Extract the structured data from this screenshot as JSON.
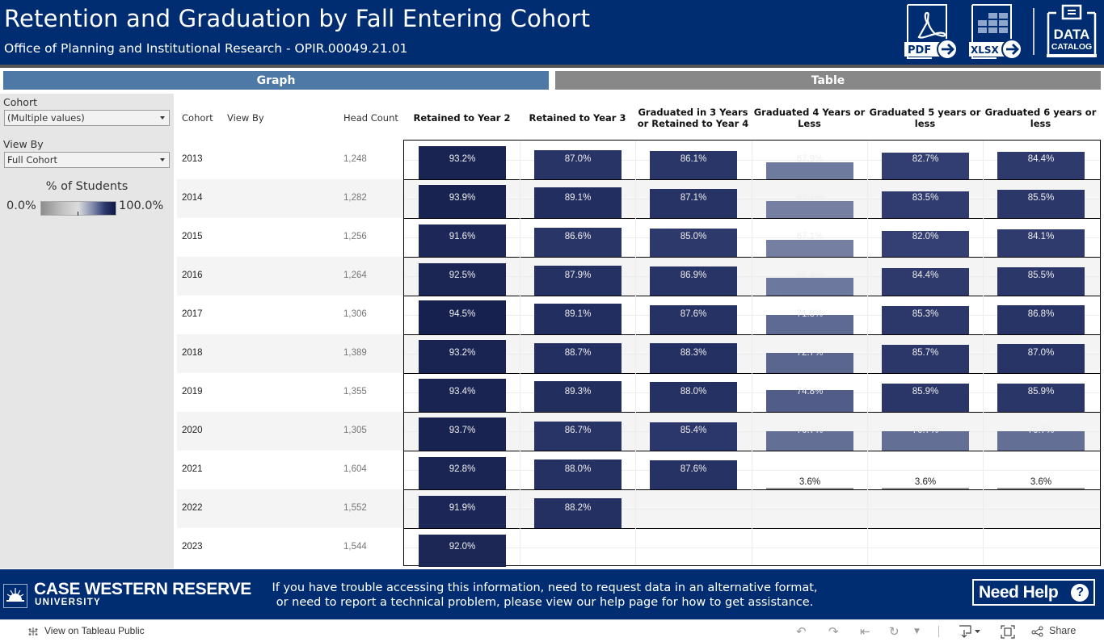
{
  "header": {
    "title": "Retention and Graduation by Fall Entering Cohort",
    "subtitle": "Office of Planning and Institutional Research - OPIR.00049.21.01",
    "pdf_label": "PDF",
    "xlsx_label": "XLSX",
    "catalog_line1": "DATA",
    "catalog_line2": "CATALOG"
  },
  "tabs": [
    {
      "label": "Graph",
      "color": "#4e79a7"
    },
    {
      "label": "Table",
      "color": "#888888"
    }
  ],
  "filters": {
    "cohort": {
      "label": "Cohort",
      "value": "(Multiple values)"
    },
    "view_by": {
      "label": "View By",
      "value": "Full Cohort"
    }
  },
  "legend": {
    "title": "% of Students",
    "min": "0.0%",
    "max": "100.0%"
  },
  "table": {
    "columns": {
      "cohort": "Cohort",
      "view_by": "View By",
      "head_count": "Head Count",
      "metrics": [
        "Retained to Year 2",
        "Retained to Year 3",
        "Graduated in 3 Years or Retained to Year 4",
        "Graduated 4 Years or Less",
        "Graduated 5 years or less",
        "Graduated 6 years or less"
      ]
    },
    "rows": [
      {
        "cohort": "2013",
        "head_count": "1,248",
        "values": [
          93.2,
          87.0,
          86.1,
          67.9,
          82.7,
          84.4
        ]
      },
      {
        "cohort": "2014",
        "head_count": "1,282",
        "values": [
          93.9,
          89.1,
          87.1,
          67.1,
          83.5,
          85.5
        ]
      },
      {
        "cohort": "2015",
        "head_count": "1,256",
        "values": [
          91.6,
          86.6,
          85.0,
          67.1,
          82.0,
          84.1
        ]
      },
      {
        "cohort": "2016",
        "head_count": "1,264",
        "values": [
          92.5,
          87.9,
          86.9,
          68.4,
          84.4,
          85.5
        ]
      },
      {
        "cohort": "2017",
        "head_count": "1,306",
        "values": [
          94.5,
          89.1,
          87.6,
          71.8,
          85.3,
          86.8
        ]
      },
      {
        "cohort": "2018",
        "head_count": "1,389",
        "values": [
          93.2,
          88.7,
          88.3,
          72.7,
          85.7,
          87.0
        ]
      },
      {
        "cohort": "2019",
        "head_count": "1,355",
        "values": [
          93.4,
          89.3,
          88.0,
          74.8,
          85.9,
          85.9
        ]
      },
      {
        "cohort": "2020",
        "head_count": "1,305",
        "values": [
          93.7,
          86.7,
          85.4,
          70.7,
          70.7,
          70.7
        ]
      },
      {
        "cohort": "2021",
        "head_count": "1,604",
        "values": [
          92.8,
          88.0,
          87.6,
          3.6,
          3.6,
          3.6
        ]
      },
      {
        "cohort": "2022",
        "head_count": "1,552",
        "values": [
          91.9,
          88.2,
          null,
          null,
          null,
          null
        ]
      },
      {
        "cohort": "2023",
        "head_count": "1,544",
        "values": [
          92.0,
          null,
          null,
          null,
          null,
          null
        ]
      }
    ]
  },
  "chart_data": {
    "type": "heatmap",
    "title": "Retention and Graduation by Fall Entering Cohort",
    "xlabel": "",
    "ylabel": "Cohort",
    "categories": [
      "2013",
      "2014",
      "2015",
      "2016",
      "2017",
      "2018",
      "2019",
      "2020",
      "2021",
      "2022",
      "2023"
    ],
    "head_count": [
      1248,
      1282,
      1256,
      1264,
      1306,
      1389,
      1355,
      1305,
      1604,
      1552,
      1544
    ],
    "series": [
      {
        "name": "Retained to Year 2",
        "values": [
          93.2,
          93.9,
          91.6,
          92.5,
          94.5,
          93.2,
          93.4,
          93.7,
          92.8,
          91.9,
          92.0
        ]
      },
      {
        "name": "Retained to Year 3",
        "values": [
          87.0,
          89.1,
          86.6,
          87.9,
          89.1,
          88.7,
          89.3,
          86.7,
          88.0,
          88.2,
          null
        ]
      },
      {
        "name": "Graduated in 3 Years or Retained to Year 4",
        "values": [
          86.1,
          87.1,
          85.0,
          86.9,
          87.6,
          88.3,
          88.0,
          85.4,
          87.6,
          null,
          null
        ]
      },
      {
        "name": "Graduated 4 Years or Less",
        "values": [
          67.9,
          67.1,
          67.1,
          68.4,
          71.8,
          72.7,
          74.8,
          70.7,
          3.6,
          null,
          null
        ]
      },
      {
        "name": "Graduated 5 years or less",
        "values": [
          82.7,
          83.5,
          82.0,
          84.4,
          85.3,
          85.7,
          85.9,
          70.7,
          3.6,
          null,
          null
        ]
      },
      {
        "name": "Graduated 6 years or less",
        "values": [
          84.4,
          85.5,
          84.1,
          85.5,
          86.8,
          87.0,
          85.9,
          70.7,
          3.6,
          null,
          null
        ]
      }
    ],
    "value_unit": "%",
    "color_range": [
      0,
      100
    ],
    "colors": {
      "low": "#8d8d8d",
      "mid": "#dcdcdc",
      "high": "#0e1744"
    },
    "legend": "left"
  },
  "footer": {
    "university": "CASE WESTERN RESERVE",
    "university_sub": "UNIVERSITY",
    "help_line1": "If you have trouble accessing this information, need to request data in an alternative format,",
    "help_line2": "or need to report a technical problem, please view our help page for how to get assistance.",
    "need_help": "Need Help",
    "need_help_icon": "?"
  },
  "toolbar": {
    "tableau_link": "View on Tableau Public",
    "share": "Share"
  },
  "colors": {
    "header_bg": "#002d72",
    "accent": "#4e79a7"
  }
}
